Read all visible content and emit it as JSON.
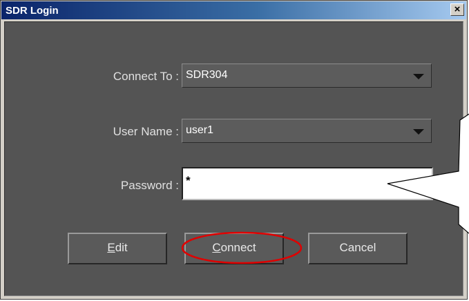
{
  "window": {
    "title": "SDR Login",
    "close_glyph": "×"
  },
  "form": {
    "connect_to": {
      "label": "Connect To :",
      "value": "SDR304"
    },
    "user_name": {
      "label": "User Name :",
      "value": "user1"
    },
    "password": {
      "label": "Password :",
      "value": "*"
    }
  },
  "buttons": {
    "edit": {
      "mnemonic": "E",
      "rest": "dit"
    },
    "connect": {
      "mnemonic": "C",
      "rest": "onnect"
    },
    "cancel": {
      "label": "Cancel"
    }
  },
  "annotations": {
    "highlight_color": "#e00000",
    "callout_color": "#ffffff"
  },
  "icons": {
    "close": "close-icon",
    "dropdown": "chevron-down-icon"
  }
}
